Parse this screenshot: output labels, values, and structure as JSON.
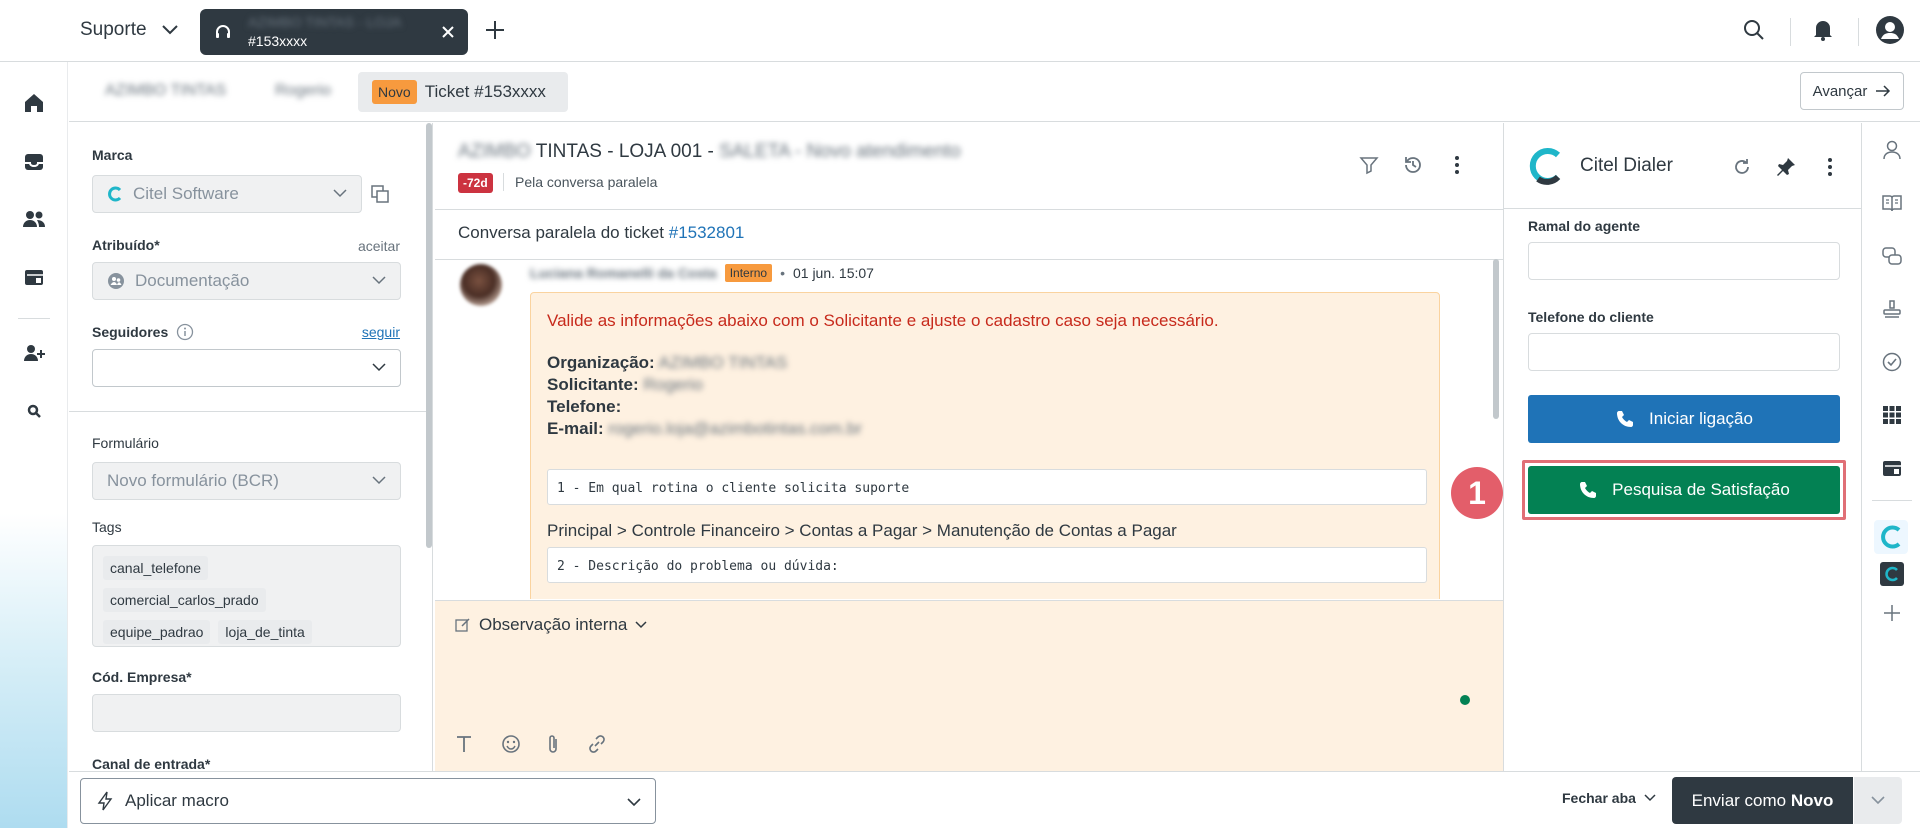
{
  "topbar": {
    "product_name": "Suporte",
    "active_tab_line1": "AZIMBO TINTAS - LOJA",
    "active_tab_line2": "#153xxxx"
  },
  "tabs": {
    "org_crumb": "AZIMBO TINTAS",
    "requester_crumb": "Rogerio",
    "status_badge": "Novo",
    "ticket_label": "Ticket #153xxxx",
    "advance_label": "Avançar"
  },
  "props": {
    "brand_label": "Marca",
    "brand_value": "Citel Software",
    "assignee_label": "Atribuído*",
    "assignee_action": "aceitar",
    "assignee_value": "Documentação",
    "followers_label": "Seguidores",
    "followers_action": "seguir",
    "form_label": "Formulário",
    "form_value": "Novo formulário (BCR)",
    "tags_label": "Tags",
    "tags": [
      "canal_telefone",
      "comercial_carlos_prado",
      "equipe_padrao",
      "loja_de_tinta"
    ],
    "company_code_label": "Cód. Empresa*",
    "entry_channel_label": "Canal de entrada*"
  },
  "conversation": {
    "title_blur_prefix": "AZIMBO",
    "title_main": "TINTAS - LOJA 001 -",
    "title_blur_suffix": "SALETA - Novo atendimento",
    "age_badge": "-72d",
    "via_text": "Pela conversa paralela",
    "side_note_prefix": "Conversa paralela do ticket ",
    "side_note_link": "#1532801",
    "author_name": "Luciana Romanelli da Costa",
    "author_badge": "Interno",
    "timestamp": "01 jun. 15:07",
    "warning_text": "Valide as informações abaixo com o Solicitante e ajuste o cadastro caso seja necessário.",
    "org_label": "Organização:",
    "org_value": "AZIMBO TINTAS",
    "requester_label": "Solicitante:",
    "requester_value": "Rogerio",
    "phone_label": "Telefone:",
    "email_label": "E-mail:",
    "email_value": "rogerio.loja@azimbotintas.com.br",
    "code1": "1 - Em qual rotina o cliente solicita suporte",
    "path_line": "Principal > Controle Financeiro > Contas a Pagar > Manutenção de Contas a Pagar",
    "code2": "2 - Descrição do problema ou dúvida:",
    "composer_type": "Observação interna"
  },
  "dialer": {
    "title": "Citel Dialer",
    "agent_ext_label": "Ramal do agente",
    "client_phone_label": "Telefone do cliente",
    "call_button": "Iniciar ligação",
    "survey_button": "Pesquisa de Satisfação",
    "step_number": "1"
  },
  "bottom": {
    "macro_label": "Aplicar macro",
    "close_tab_label": "Fechar aba",
    "submit_prefix": "Enviar como ",
    "submit_status": "Novo"
  },
  "colors": {
    "primary_blue": "#1f73b7",
    "success_green": "#038153",
    "dark": "#2f3941",
    "internal_note_bg": "#fef1e1",
    "highlight_red": "#e35e6a"
  }
}
